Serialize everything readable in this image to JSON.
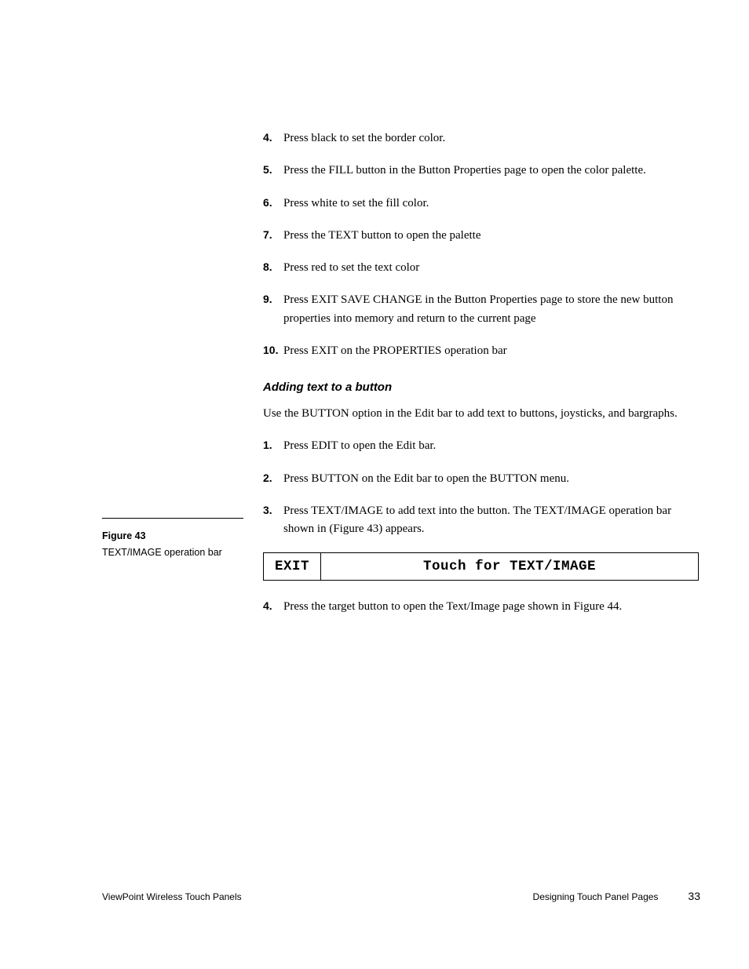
{
  "list1": [
    {
      "num": "4.",
      "text": "Press black to set the border color."
    },
    {
      "num": "5.",
      "text": "Press the FILL button in the Button Properties page to open the color palette."
    },
    {
      "num": "6.",
      "text": "Press white to set the fill color."
    },
    {
      "num": "7.",
      "text": "Press the TEXT button to open the palette"
    },
    {
      "num": "8.",
      "text": "Press red to set the text color"
    },
    {
      "num": "9.",
      "text": "Press EXIT SAVE CHANGE in the Button Properties page to store the new button properties into memory and return to the current page"
    },
    {
      "num": "10.",
      "text": "Press EXIT on the PROPERTIES operation bar"
    }
  ],
  "section_heading": "Adding text to a button",
  "intro": "Use the BUTTON option in the Edit bar to add text to buttons, joysticks, and bargraphs.",
  "list2": [
    {
      "num": "1.",
      "text": "Press EDIT to open the Edit bar."
    },
    {
      "num": "2.",
      "text": "Press BUTTON on the Edit bar to open the BUTTON menu."
    },
    {
      "num": "3.",
      "text": "Press TEXT/IMAGE to add text into the button. The TEXT/IMAGE operation bar shown in (Figure 43) appears."
    }
  ],
  "sidebar": {
    "label": "Figure 43",
    "caption": "TEXT/IMAGE operation bar"
  },
  "opbar": {
    "exit": "EXIT",
    "text": "Touch for TEXT/IMAGE"
  },
  "list3": [
    {
      "num": "4.",
      "text": "Press the target button to open the Text/Image page shown in Figure 44."
    }
  ],
  "footer": {
    "left": "ViewPoint Wireless Touch Panels",
    "right": "Designing Touch Panel Pages",
    "page": "33"
  }
}
